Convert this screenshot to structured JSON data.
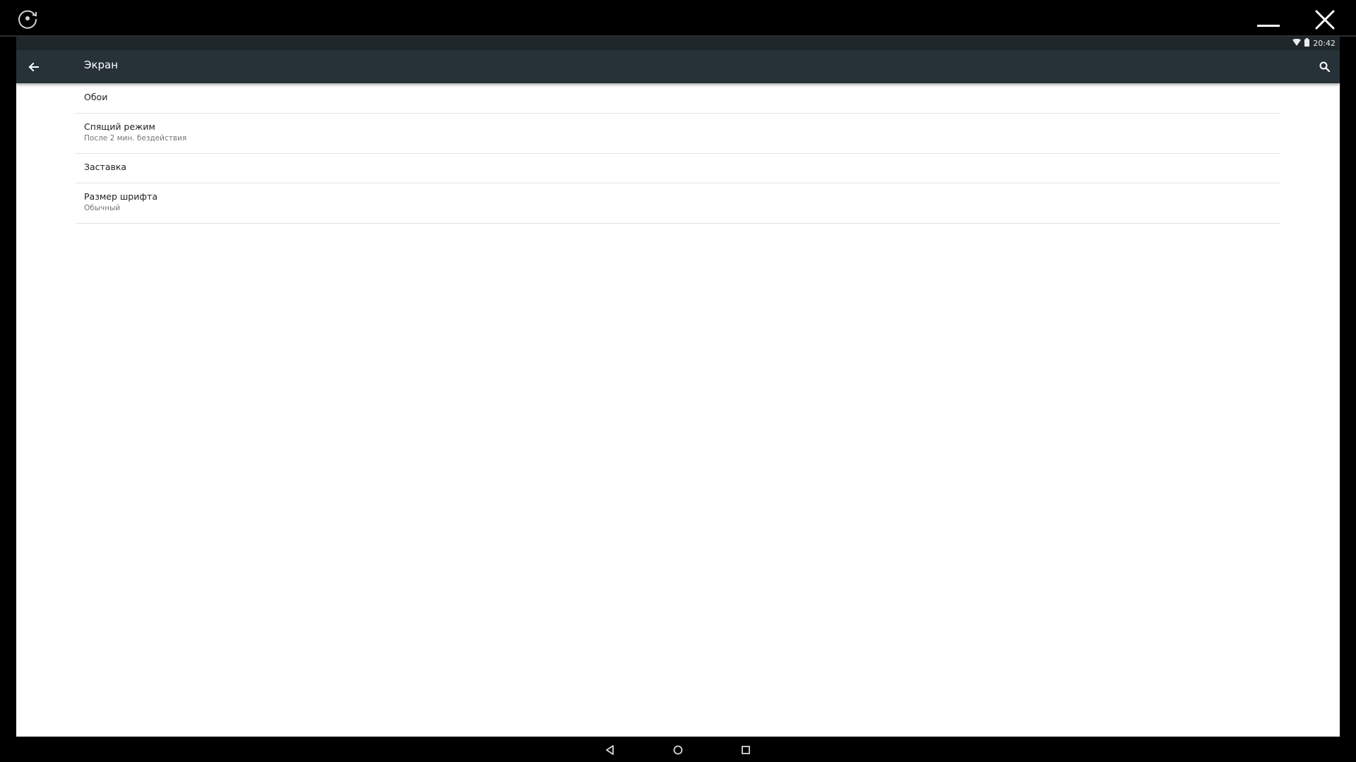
{
  "window": {
    "rotate_icon": "rotate-icon",
    "minimize_icon": "minimize-icon",
    "close_icon": "close-icon"
  },
  "statusbar": {
    "wifi_icon": "wifi-icon",
    "battery_icon": "battery-icon",
    "time": "20:42"
  },
  "appbar": {
    "back_icon": "arrow-back-icon",
    "title": "Экран",
    "search_icon": "search-icon"
  },
  "settings": {
    "items": [
      {
        "title": "Обои"
      },
      {
        "title": "Спящий режим",
        "subtitle": "После 2 мин. бездействия"
      },
      {
        "title": "Заставка"
      },
      {
        "title": "Размер шрифта",
        "subtitle": "Обычный"
      }
    ]
  },
  "navbar": {
    "back_icon": "nav-back-icon",
    "home_icon": "nav-home-icon",
    "recents_icon": "nav-recents-icon"
  },
  "colors": {
    "appbar": "#263238",
    "statusbar": "#20272b",
    "background": "#ffffff"
  }
}
